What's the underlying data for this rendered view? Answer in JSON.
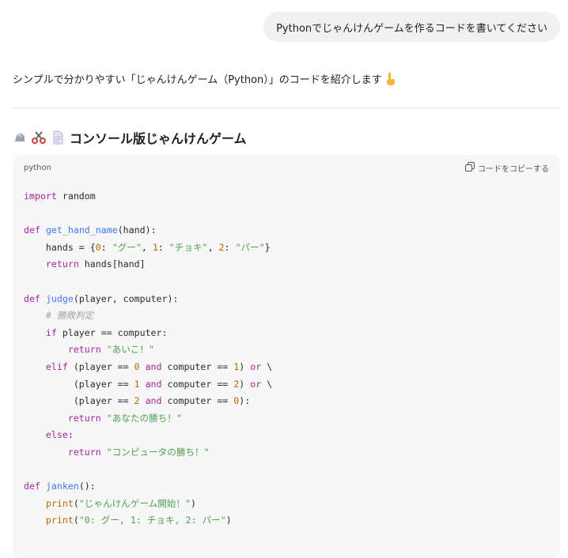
{
  "chat": {
    "user_message": "Pythonでじゃんけんゲームを作るコードを書いてください",
    "intro_text": "シンプルで分かりやすい「じゃんけんゲーム（Python）」のコードを紹介します",
    "section_title": "コンソール版じゃんけんゲーム"
  },
  "code_block": {
    "language": "python",
    "copy_label": "コードをコピーする"
  },
  "code": {
    "l1_a": "import",
    "l1_b": " random",
    "l3_a": "def",
    "l3_b": "get_hand_name",
    "l3_c": "(hand):",
    "l4_a": "    hands = {",
    "l4_b": "0",
    "l4_c": ": ",
    "l4_d": "\"グー\"",
    "l4_e": ", ",
    "l4_f": "1",
    "l4_g": ": ",
    "l4_h": "\"チョキ\"",
    "l4_i": ", ",
    "l4_j": "2",
    "l4_k": ": ",
    "l4_l": "\"パー\"",
    "l4_m": "}",
    "l5_a": "    ",
    "l5_b": "return",
    "l5_c": " hands[hand]",
    "l7_a": "def",
    "l7_b": "judge",
    "l7_c": "(player, computer):",
    "l8_a": "    ",
    "l8_b": "# 勝敗判定",
    "l9_a": "    ",
    "l9_b": "if",
    "l9_c": " player == computer:",
    "l10_a": "        ",
    "l10_b": "return",
    "l10_c": "\"あいこ！\"",
    "l11_a": "    ",
    "l11_b": "elif",
    "l11_c": " (player == ",
    "l11_d": "0",
    "l11_e": "and",
    "l11_f": " computer == ",
    "l11_g": "1",
    "l11_h": ") ",
    "l11_i": "or",
    "l11_j": " \\",
    "l12_a": "         (player == ",
    "l12_b": "1",
    "l12_c": "and",
    "l12_d": " computer == ",
    "l12_e": "2",
    "l12_f": ") ",
    "l12_g": "or",
    "l12_h": " \\",
    "l13_a": "         (player == ",
    "l13_b": "2",
    "l13_c": "and",
    "l13_d": " computer == ",
    "l13_e": "0",
    "l13_f": "):",
    "l14_a": "        ",
    "l14_b": "return",
    "l14_c": "\"あなたの勝ち！\"",
    "l15_a": "    ",
    "l15_b": "else",
    "l15_c": ":",
    "l16_a": "        ",
    "l16_b": "return",
    "l16_c": "\"コンピュータの勝ち！\"",
    "l18_a": "def",
    "l18_b": "janken",
    "l18_c": "():",
    "l19_a": "    ",
    "l19_b": "print",
    "l19_c": "(",
    "l19_d": "\"じゃんけんゲーム開始！\"",
    "l19_e": ")",
    "l20_a": "    ",
    "l20_b": "print",
    "l20_c": "(",
    "l20_d": "\"0: グー, 1: チョキ, 2: パー\"",
    "l20_e": ")"
  },
  "icons": {
    "intro_emoji": "pointing-down-icon",
    "heading_emojis": [
      "rock-icon",
      "scissors-icon",
      "paper-icon"
    ],
    "copy": "copy-icon"
  },
  "colors": {
    "keyword": "#a626a4",
    "function": "#4078f2",
    "string": "#50a14f",
    "number": "#b76b01",
    "comment": "#a0a1a7"
  }
}
